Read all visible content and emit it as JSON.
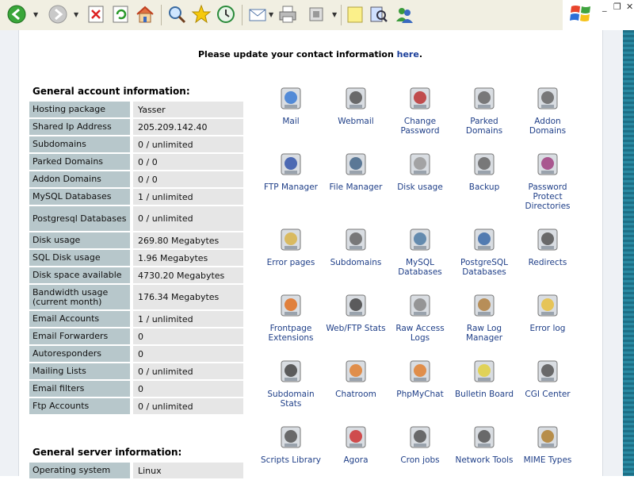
{
  "notice": {
    "text": "Please update your contact information ",
    "link": "here",
    "end": "."
  },
  "general_title": "General account information:",
  "stats": [
    {
      "k": "Hosting package",
      "v": "Yasser",
      "h": 20
    },
    {
      "k": "Shared Ip Address",
      "v": "205.209.142.40",
      "h": 20
    },
    {
      "k": "Subdomains",
      "v": "0 / unlimited",
      "h": 20
    },
    {
      "k": "Parked Domains",
      "v": "0 / 0",
      "h": 20
    },
    {
      "k": "Addon Domains",
      "v": "0 / 0",
      "h": 20
    },
    {
      "k": "MySQL Databases",
      "v": "1 / unlimited",
      "h": 20
    },
    {
      "k": "Postgresql Databases",
      "v": "0 / unlimited",
      "h": 31
    },
    {
      "k": "Disk usage",
      "v": "269.80 Megabytes",
      "h": 20
    },
    {
      "k": "SQL Disk usage",
      "v": "1.96 Megabytes",
      "h": 20
    },
    {
      "k": "Disk space available",
      "v": "4730.20 Megabytes",
      "h": 20
    },
    {
      "k": "Bandwidth usage (current month)",
      "v": "176.34 Megabytes",
      "h": 31
    },
    {
      "k": "Email Accounts",
      "v": "1 / unlimited",
      "h": 20
    },
    {
      "k": "Email Forwarders",
      "v": "0",
      "h": 20
    },
    {
      "k": "Autoresponders",
      "v": "0",
      "h": 20
    },
    {
      "k": "Mailing Lists",
      "v": "0 / unlimited",
      "h": 20
    },
    {
      "k": "Email filters",
      "v": "0",
      "h": 20
    },
    {
      "k": "Ftp Accounts",
      "v": "0 / unlimited",
      "h": 20
    }
  ],
  "server_title": "General server information:",
  "server": [
    {
      "k": "Operating system",
      "v": "Linux"
    }
  ],
  "icons": [
    {
      "label": "Mail",
      "icon": "mail-icon",
      "c": "#3a7bd5"
    },
    {
      "label": "Webmail",
      "icon": "webmail-icon",
      "c": "#555"
    },
    {
      "label": "Change Password",
      "icon": "change-password-icon",
      "c": "#b33"
    },
    {
      "label": "Parked Domains",
      "icon": "parked-domains-icon",
      "c": "#666"
    },
    {
      "label": "Addon Domains",
      "icon": "addon-domains-icon",
      "c": "#666"
    },
    {
      "label": "FTP Manager",
      "icon": "ftp-manager-icon",
      "c": "#3355aa"
    },
    {
      "label": "File Manager",
      "icon": "file-manager-icon",
      "c": "#446688"
    },
    {
      "label": "Disk usage",
      "icon": "disk-usage-icon",
      "c": "#999"
    },
    {
      "label": "Backup",
      "icon": "backup-icon",
      "c": "#666"
    },
    {
      "label": "Password Protect Directories",
      "icon": "password-protect-icon",
      "c": "#a04080"
    },
    {
      "label": "Error pages",
      "icon": "error-pages-icon",
      "c": "#d8b44a"
    },
    {
      "label": "Subdomains",
      "icon": "subdomains-icon",
      "c": "#666"
    },
    {
      "label": "MySQL Databases",
      "icon": "mysql-icon",
      "c": "#4f7da6"
    },
    {
      "label": "PostgreSQL Databases",
      "icon": "postgresql-icon",
      "c": "#3a6aa8"
    },
    {
      "label": "Redirects",
      "icon": "redirects-icon",
      "c": "#555"
    },
    {
      "label": "Frontpage Extensions",
      "icon": "frontpage-icon",
      "c": "#e07020"
    },
    {
      "label": "Web/FTP Stats",
      "icon": "web-ftp-stats-icon",
      "c": "#444"
    },
    {
      "label": "Raw Access Logs",
      "icon": "raw-access-logs-icon",
      "c": "#888"
    },
    {
      "label": "Raw Log Manager",
      "icon": "raw-log-manager-icon",
      "c": "#b08040"
    },
    {
      "label": "Error log",
      "icon": "error-log-icon",
      "c": "#e8c040"
    },
    {
      "label": "Subdomain Stats",
      "icon": "subdomain-stats-icon",
      "c": "#444"
    },
    {
      "label": "Chatroom",
      "icon": "chatroom-icon",
      "c": "#e08030"
    },
    {
      "label": "PhpMyChat",
      "icon": "phpmychat-icon",
      "c": "#e08030"
    },
    {
      "label": "Bulletin Board",
      "icon": "bulletin-board-icon",
      "c": "#e0d040"
    },
    {
      "label": "CGI Center",
      "icon": "cgi-center-icon",
      "c": "#555"
    },
    {
      "label": "Scripts Library",
      "icon": "scripts-library-icon",
      "c": "#555"
    },
    {
      "label": "Agora",
      "icon": "agora-icon",
      "c": "#cc3333"
    },
    {
      "label": "Cron jobs",
      "icon": "cron-jobs-icon",
      "c": "#555"
    },
    {
      "label": "Network Tools",
      "icon": "network-tools-icon",
      "c": "#555"
    },
    {
      "label": "MIME Types",
      "icon": "mime-types-icon",
      "c": "#b08030"
    }
  ]
}
